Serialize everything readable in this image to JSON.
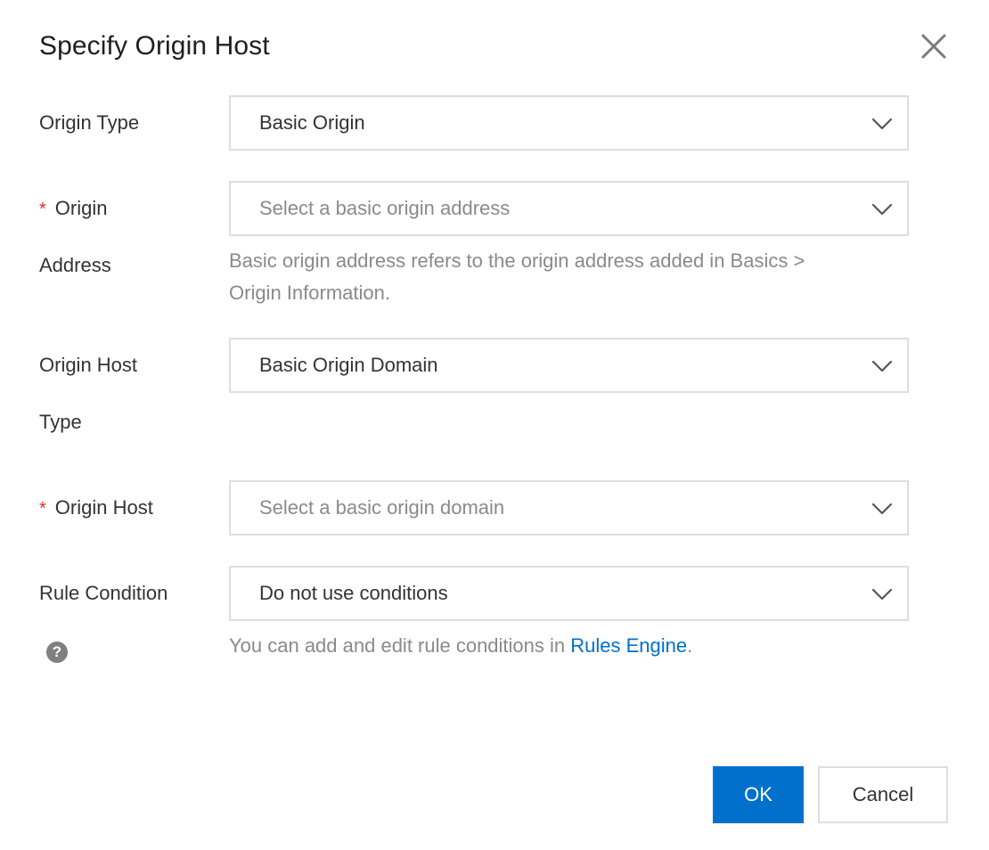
{
  "dialog": {
    "title": "Specify Origin Host",
    "close_icon": "close-icon"
  },
  "fields": {
    "origin_type": {
      "label": "Origin Type",
      "value": "Basic Origin"
    },
    "origin_address": {
      "required_mark": "*",
      "label_line1": "Origin",
      "label_line2": "Address",
      "placeholder": "Select a basic origin address",
      "help_line1": "Basic origin address refers to the origin address added in Basics >",
      "help_line2": "Origin Information."
    },
    "origin_host_type": {
      "label_line1": "Origin Host",
      "label_line2": "Type",
      "value": "Basic Origin Domain"
    },
    "origin_host": {
      "required_mark": "*",
      "label": "Origin Host",
      "placeholder": "Select a basic origin domain"
    },
    "rule_condition": {
      "label": "Rule Condition",
      "help_icon": "question-circle-icon",
      "help_icon_glyph": "?",
      "value": "Do not use conditions",
      "help_prefix": "You can add and edit rule conditions in ",
      "help_link": "Rules Engine",
      "help_suffix": "."
    }
  },
  "footer": {
    "ok_label": "OK",
    "cancel_label": "Cancel"
  },
  "colors": {
    "primary": "#0070cc",
    "required": "#d93026",
    "border": "#dedede",
    "muted_text": "#8a8a8a"
  }
}
